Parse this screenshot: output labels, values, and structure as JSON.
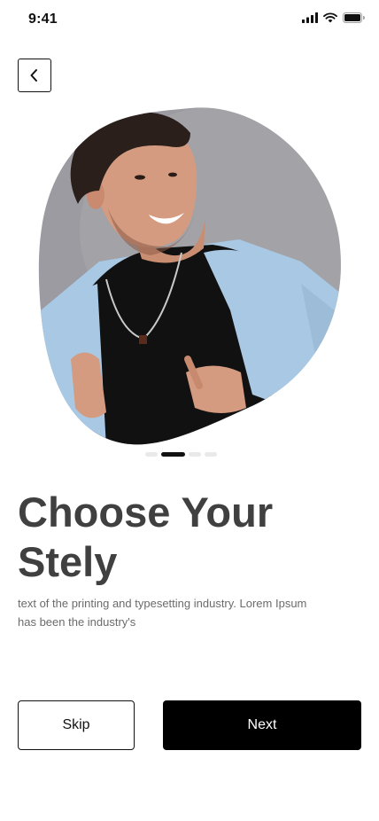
{
  "status_bar": {
    "time": "9:41",
    "icons": [
      "cellular-signal-icon",
      "wifi-icon",
      "battery-icon"
    ]
  },
  "header": {
    "back_icon": "chevron-left-icon"
  },
  "hero": {
    "image": "man-in-black-tshirt-with-blue-sweater-photo"
  },
  "pager": {
    "count": 4,
    "active_index": 1
  },
  "content": {
    "title": "Choose Your Stely",
    "description": "text of the printing and typesetting industry. Lorem Ipsum has been the industry's"
  },
  "actions": {
    "skip_label": "Skip",
    "next_label": "Next"
  },
  "colors": {
    "primary": "#000000",
    "title_text": "#404040",
    "body_text": "#6b6b6b",
    "hero_bg": "#9b9ba1",
    "sweater": "#a9c8e4"
  }
}
